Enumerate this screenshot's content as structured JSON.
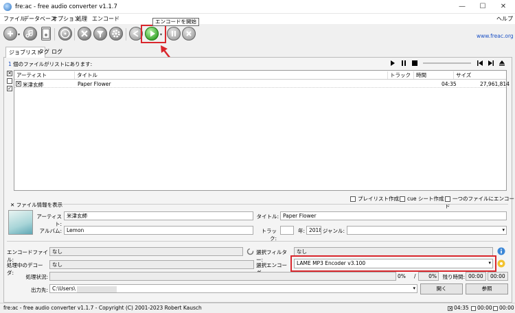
{
  "window": {
    "title": "fre:ac - free audio converter v1.1.7",
    "minimize_glyph": "—",
    "maximize_glyph": "☐",
    "close_glyph": "✕"
  },
  "menu": {
    "file": "ファイル",
    "database": "データベース",
    "options": "オプション",
    "process": "処理",
    "encode": "エンコード",
    "help": "ヘルプ"
  },
  "toolbar": {
    "tooltip": "エンコードを開始",
    "link": "www.freac.org",
    "dropdown_glyph": "▾",
    "icons": [
      "add-icon",
      "cd-icon",
      "file-icon",
      "cddb-icon",
      "tools-icon",
      "filter-icon",
      "gear-icon",
      "share-icon",
      "play-icon",
      "pause-icon",
      "stop-icon"
    ]
  },
  "tabs": {
    "joblist": "ジョブリスト",
    "tag": "タグ",
    "log": "ログ"
  },
  "joblist": {
    "count_prefix": "1",
    "count_text": " 個のファイルがリストにあります:",
    "columns": [
      "アーティスト",
      "タイトル",
      "トラック",
      "時間",
      "サイズ"
    ],
    "rows": [
      {
        "checked": "✕",
        "artist": "米津玄師",
        "title": "Paper Flower",
        "track": "",
        "time": "04:35",
        "size": "27,961,814"
      }
    ],
    "side_checks": [
      "✕",
      "",
      "✓"
    ]
  },
  "options": {
    "playlist": "プレイリスト作成",
    "cue": "cue シート作成",
    "single_file": "一つのファイルにエンコード"
  },
  "fileinfo": {
    "toggle_mark": "✕",
    "toggle_label": "ファイル情報を表示",
    "artist_label": "アーティスト:",
    "artist": "米津玄師",
    "title_label": "タイトル:",
    "title": "Paper Flower",
    "album_label": "アルバム:",
    "album": "Lemon",
    "track_label": "トラック:",
    "track": "",
    "year_label": "年:",
    "year": "2018",
    "genre_label": "ジャンル:",
    "genre": ""
  },
  "encode": {
    "encoding_file_label": "エンコードファイル:",
    "encoding_file": "なし",
    "selected_filter_label": "選択フィルター:",
    "selected_filter": "なし",
    "decoder_label": "処理中のデコーダ:",
    "decoder": "なし",
    "encoder_label": "選択エンコーダ:",
    "encoder": "LAME MP3 Encoder v3.100",
    "status_label": "処理状況:",
    "progress_file": "0%",
    "progress_sep": "/",
    "progress_total": "0%",
    "remaining_label": "残り時間:",
    "time_elapsed": "00:00",
    "time_remaining": "00:00",
    "output_label": "出力先:",
    "output_path": "C:\\Users\\",
    "open_button": "開く",
    "browse_button": "参照"
  },
  "statusbar": {
    "text": "fre:ac - free audio converter v1.1.7 - Copyright (C) 2001-2023 Robert Kausch",
    "selected_time": "04:35",
    "mark1": "✕",
    "time2": "00:00",
    "time3": "00:00"
  },
  "colors": {
    "highlight": "#d9262c",
    "link": "#1a4fc4",
    "play": "#2f9e24"
  }
}
